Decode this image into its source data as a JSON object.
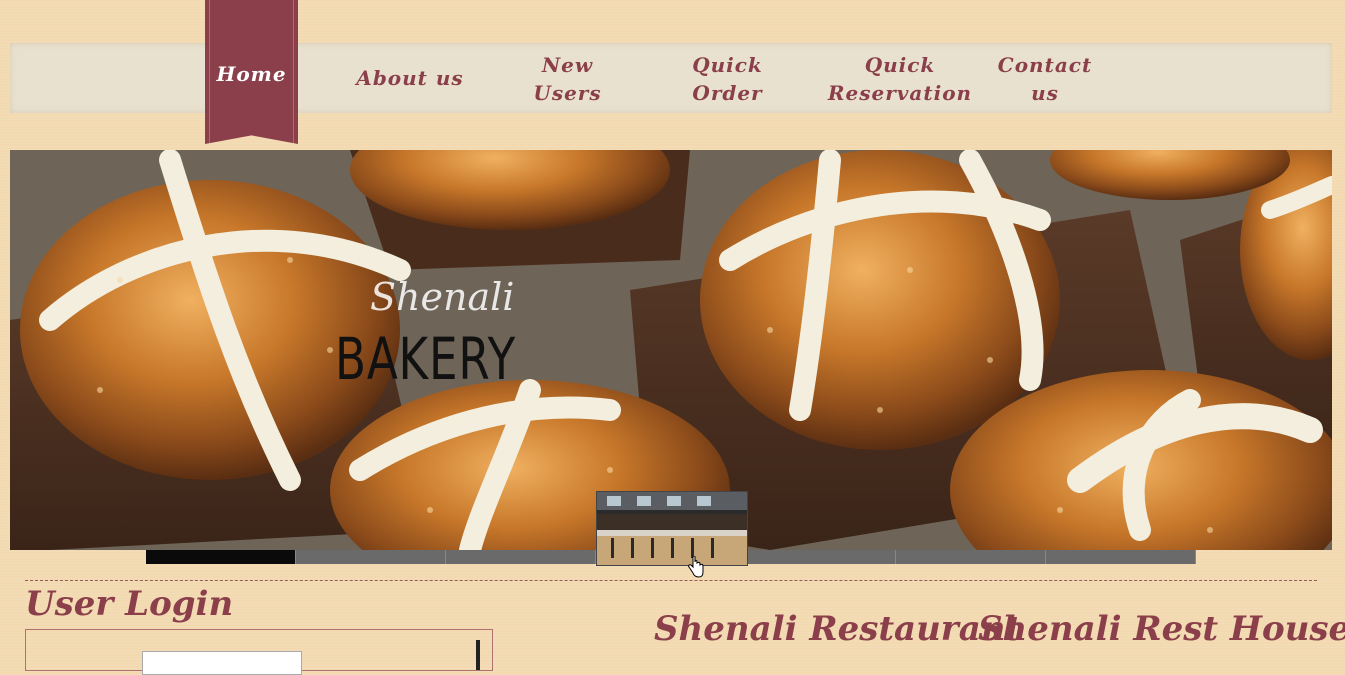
{
  "nav": {
    "home": "Home",
    "about": "About us",
    "new_users": [
      "New",
      "Users"
    ],
    "quick_order": [
      "Quick",
      "Order"
    ],
    "quick_reservation": [
      "Quick",
      "Reservation"
    ],
    "contact": [
      "Contact",
      "us"
    ]
  },
  "hero": {
    "brand_script": "Shenali",
    "brand_word": "BAKERY"
  },
  "slider": {
    "slide_count": 7,
    "active_index": 0
  },
  "login": {
    "title": "User Login"
  },
  "sections": {
    "restaurant": "Shenali Restaurant",
    "rest_house": "Shenali Rest House"
  },
  "colors": {
    "accent": "#8a3f4a",
    "page_bg": "#f2d9b0",
    "nav_bg": "#e8e1cf"
  }
}
